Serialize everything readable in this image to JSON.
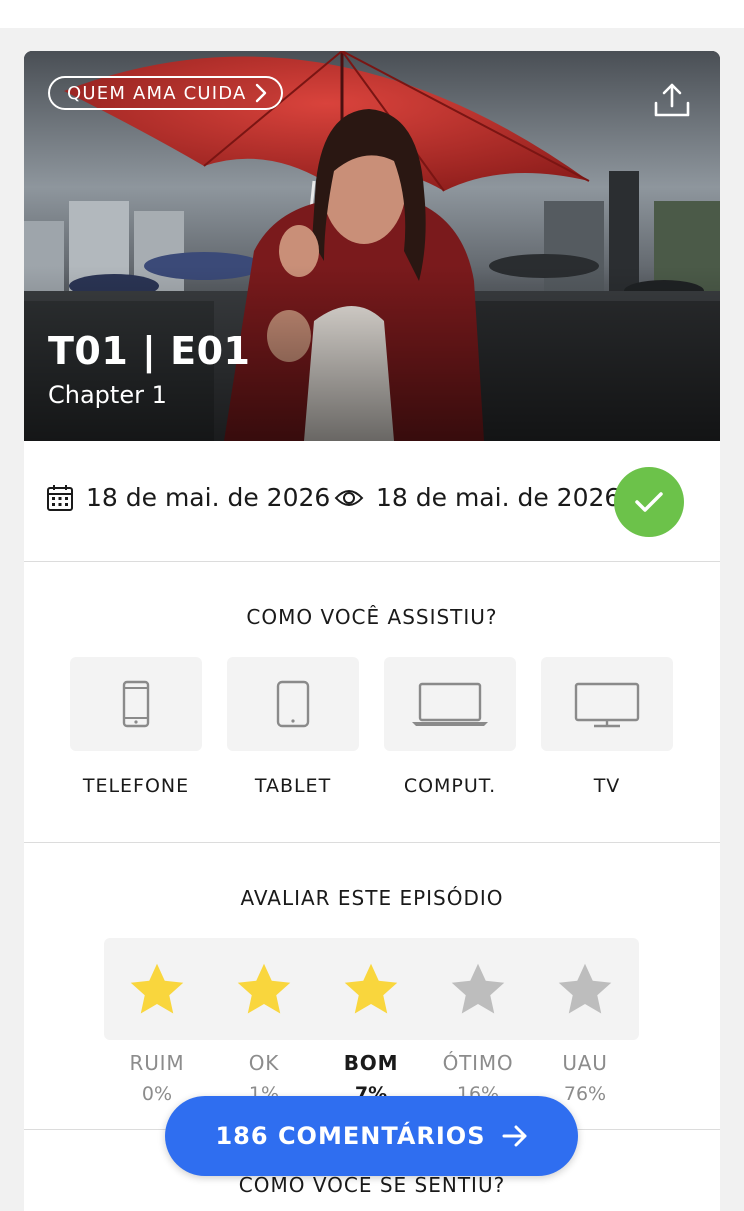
{
  "show": {
    "name": "QUEM AMA CUIDA"
  },
  "episode": {
    "code": "T01 | E01",
    "title": "Chapter 1"
  },
  "dates": {
    "aired": "18 de mai. de 2026",
    "watched": "18 de mai. de 2026"
  },
  "watch_section": {
    "title": "COMO VOCÊ ASSISTIU?",
    "devices": [
      {
        "label": "TELEFONE",
        "icon": "phone-icon"
      },
      {
        "label": "TABLET",
        "icon": "tablet-icon"
      },
      {
        "label": "COMPUT.",
        "icon": "laptop-icon"
      },
      {
        "label": "TV",
        "icon": "tv-icon"
      }
    ]
  },
  "rating_section": {
    "title": "AVALIAR ESTE EPISÓDIO",
    "selected_stars": 3,
    "options": [
      {
        "label": "RUIM",
        "percent": "0%"
      },
      {
        "label": "OK",
        "percent": "1%"
      },
      {
        "label": "BOM",
        "percent": "7%"
      },
      {
        "label": "ÓTIMO",
        "percent": "16%"
      },
      {
        "label": "UAU",
        "percent": "76%"
      }
    ]
  },
  "feelings_section": {
    "title": "COMO VOCÊ SE SENTIU?"
  },
  "comments_button": {
    "label": "186 COMENTÁRIOS"
  },
  "colors": {
    "accent_blue": "#2f6ef0",
    "check_green": "#6cc24a",
    "star_active": "#f9d63d",
    "star_inactive": "#bdbdbd"
  }
}
